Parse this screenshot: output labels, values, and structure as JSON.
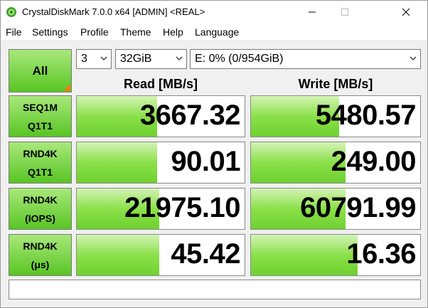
{
  "window": {
    "title": "CrystalDiskMark 7.0.0 x64 [ADMIN] <REAL>"
  },
  "icons": {
    "app": "crystaldiskmark-icon",
    "minimize": "minimize-icon",
    "maximize": "maximize-icon",
    "close": "close-icon",
    "dropdown": "chevron-down-icon"
  },
  "menu": [
    "File",
    "Settings",
    "Profile",
    "Theme",
    "Help",
    "Language"
  ],
  "controls": {
    "all_label": "All",
    "count": "3",
    "size": "32GiB",
    "drive": "E: 0% (0/954GiB)"
  },
  "headers": {
    "read": "Read [MB/s]",
    "write": "Write [MB/s]"
  },
  "tests": [
    {
      "line1": "SEQ1M",
      "line2": "Q1T1",
      "read": "3667.32",
      "write": "5480.57",
      "read_fill": 0.48,
      "write_fill": 0.52
    },
    {
      "line1": "RND4K",
      "line2": "Q1T1",
      "read": "90.01",
      "write": "249.00",
      "read_fill": 0.48,
      "write_fill": 0.56
    },
    {
      "line1": "RND4K",
      "line2": "(IOPS)",
      "read": "21975.10",
      "write": "60791.99",
      "read_fill": 0.49,
      "write_fill": 0.56
    },
    {
      "line1": "RND4K",
      "line2": "(μs)",
      "read": "45.42",
      "write": "16.36",
      "read_fill": 0.49,
      "write_fill": 0.63
    }
  ],
  "comment": ""
}
